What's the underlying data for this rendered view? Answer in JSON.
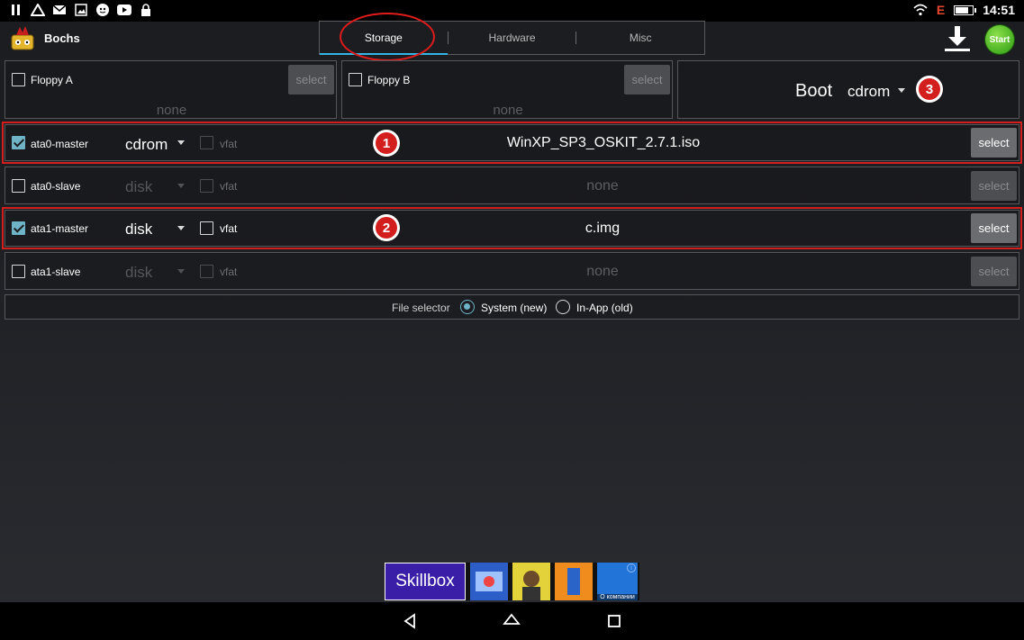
{
  "status_bar": {
    "time": "14:51",
    "left_icons": [
      "pause-icon",
      "drive-icon",
      "mail-icon",
      "image-icon",
      "android-icon",
      "youtube-icon",
      "lock-icon"
    ],
    "right_icons": [
      "wifi-icon",
      "e-signal-icon",
      "battery-icon"
    ],
    "e_label": "E",
    "battery_level": 0.8
  },
  "app": {
    "title": "Bochs",
    "start_label": "Start"
  },
  "tabs": [
    {
      "label": "Storage",
      "active": true
    },
    {
      "label": "Hardware",
      "active": false
    },
    {
      "label": "Misc",
      "active": false
    }
  ],
  "floppy": [
    {
      "label": "Floppy A",
      "checked": false,
      "value": "none",
      "select_label": "select"
    },
    {
      "label": "Floppy B",
      "checked": false,
      "value": "none",
      "select_label": "select"
    }
  ],
  "boot": {
    "label": "Boot",
    "value": "cdrom"
  },
  "drives": [
    {
      "label": "ata0-master",
      "checked": true,
      "type": "cdrom",
      "vfat_label": "vfat",
      "vfat_checked": false,
      "file": "WinXP_SP3_OSKIT_2.7.1.iso",
      "select_label": "select"
    },
    {
      "label": "ata0-slave",
      "checked": false,
      "type": "disk",
      "vfat_label": "vfat",
      "vfat_checked": false,
      "file": "none",
      "select_label": "select"
    },
    {
      "label": "ata1-master",
      "checked": true,
      "type": "disk",
      "vfat_label": "vfat",
      "vfat_checked": false,
      "file": "c.img",
      "select_label": "select"
    },
    {
      "label": "ata1-slave",
      "checked": false,
      "type": "disk",
      "vfat_label": "vfat",
      "vfat_checked": false,
      "file": "none",
      "select_label": "select"
    }
  ],
  "file_selector": {
    "label": "File selector",
    "options": [
      {
        "label": "System (new)",
        "selected": true
      },
      {
        "label": "In-App (old)",
        "selected": false
      }
    ]
  },
  "annotations": [
    "1",
    "2",
    "3"
  ],
  "ad": {
    "brand": "Skillbox",
    "caption": "О компании",
    "info": "i"
  },
  "accent_colors": {
    "tab_indicator": "#33b5e5",
    "checkbox": "#6fb3c6",
    "annotation_red": "#d31e1e",
    "start_green": "#2b9a12"
  }
}
